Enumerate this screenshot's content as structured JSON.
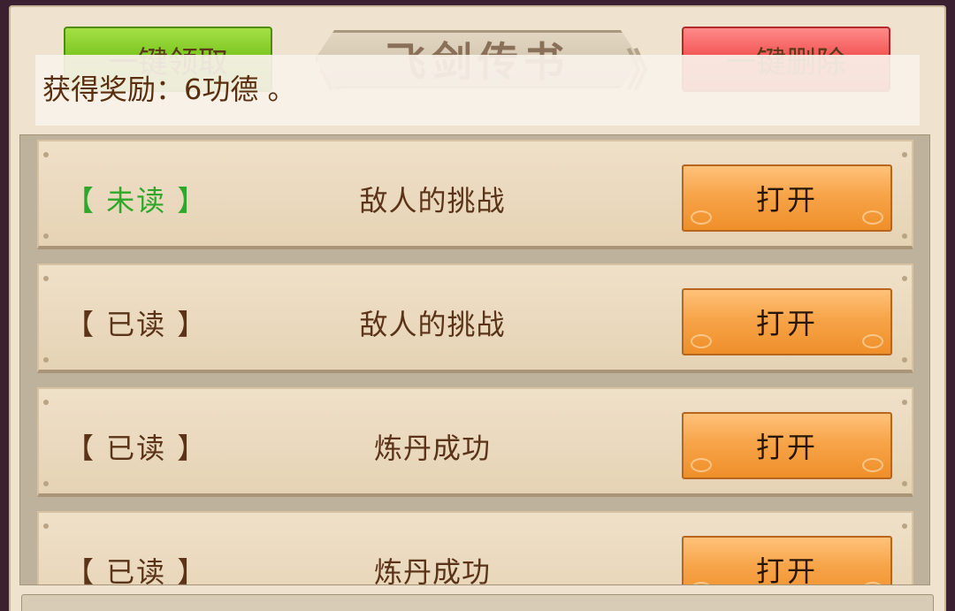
{
  "header": {
    "claim_all_label": "一键领取",
    "title": "飞剑传书",
    "delete_all_label": "一键删除"
  },
  "toast": {
    "message": "获得奖励：6功德 。"
  },
  "mail": {
    "items": [
      {
        "status": "【 未读 】",
        "subject": "敌人的挑战",
        "action": "打开"
      },
      {
        "status": "【 已读 】",
        "subject": "敌人的挑战",
        "action": "打开"
      },
      {
        "status": "【 已读 】",
        "subject": "炼丹成功",
        "action": "打开"
      },
      {
        "status": "【 已读 】",
        "subject": "炼丹成功",
        "action": "打开"
      }
    ]
  },
  "colors": {
    "unread_status": "#2fa82a",
    "read_status": "#5a3318",
    "claim_button": "#74c11a",
    "delete_button": "#f04a4a",
    "open_button": "#f7a449"
  }
}
